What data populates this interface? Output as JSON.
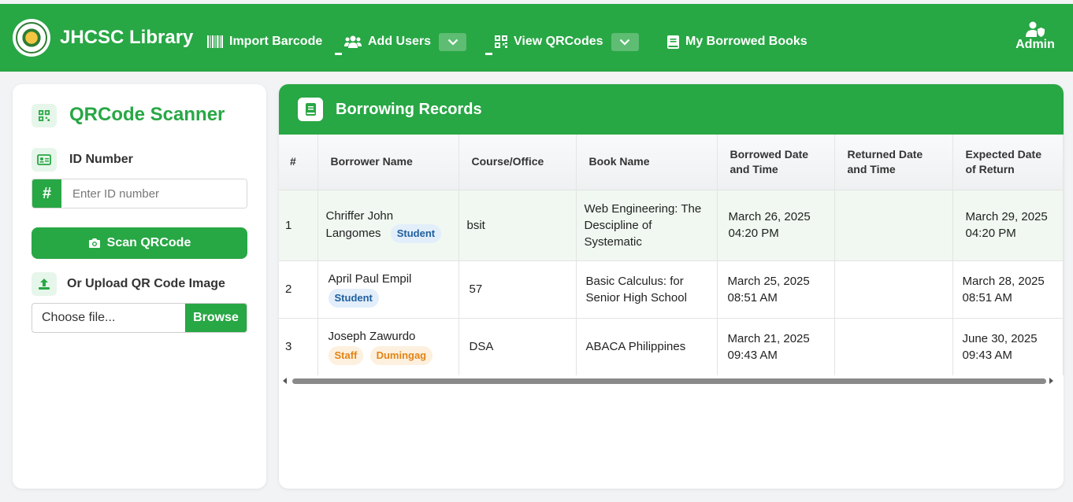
{
  "navbar": {
    "brand": "JHCSC Library",
    "items": [
      {
        "label": "Import Barcode"
      },
      {
        "label": "Add Users"
      },
      {
        "label": "View QRCodes"
      },
      {
        "label": "My Borrowed Books"
      }
    ],
    "user": "Admin"
  },
  "scanner": {
    "title": "QRCode Scanner",
    "id_label": "ID Number",
    "id_prefix": "#",
    "id_placeholder": "Enter ID number",
    "id_value": "",
    "scan_button": "Scan QRCode",
    "upload_label": "Or Upload QR Code Image",
    "file_placeholder": "Choose file...",
    "browse_button": "Browse"
  },
  "records": {
    "title": "Borrowing Records",
    "columns": [
      "#",
      "Borrower Name",
      "Course/Office",
      "Book Name",
      "Borrowed Date and Time",
      "Returned Date and Time",
      "Expected Date of Return"
    ],
    "rows": [
      {
        "num": "1",
        "name_line1": "Chriffer John",
        "name_line2": "Langomes",
        "badges": [
          "Student"
        ],
        "course": "bsit",
        "book": "Web Engineering: The Descipline of Systematic",
        "borrowed_date": "March 26, 2025",
        "borrowed_time": "04:20 PM",
        "returned": "",
        "expected_date": "March 29, 2025",
        "expected_time": "04:20 PM"
      },
      {
        "num": "2",
        "name_line1": "April Paul Empil",
        "name_line2": "",
        "badges": [
          "Student"
        ],
        "course": "57",
        "book": "Basic Calculus: for Senior High School",
        "borrowed_date": "March 25, 2025",
        "borrowed_time": "08:51 AM",
        "returned": "",
        "expected_date": "March 28, 2025",
        "expected_time": "08:51 AM"
      },
      {
        "num": "3",
        "name_line1": "Joseph Zawurdo",
        "name_line2": "",
        "badges": [
          "Staff",
          "Dumingag"
        ],
        "course": "DSA",
        "book": "ABACA Philippines",
        "borrowed_date": "March 21, 2025",
        "borrowed_time": "09:43 AM",
        "returned": "",
        "expected_date": "June 30, 2025",
        "expected_time": "09:43 AM"
      }
    ]
  },
  "colors": {
    "primary": "#28a745",
    "student_badge": "#e3eefb",
    "staff_badge": "#fdf0de"
  },
  "icons": [
    "logo",
    "barcode-icon",
    "users-icon",
    "qrcode-icon",
    "book-icon",
    "user-shield-icon",
    "id-card-icon",
    "hash-icon",
    "camera-icon",
    "upload-icon"
  ]
}
